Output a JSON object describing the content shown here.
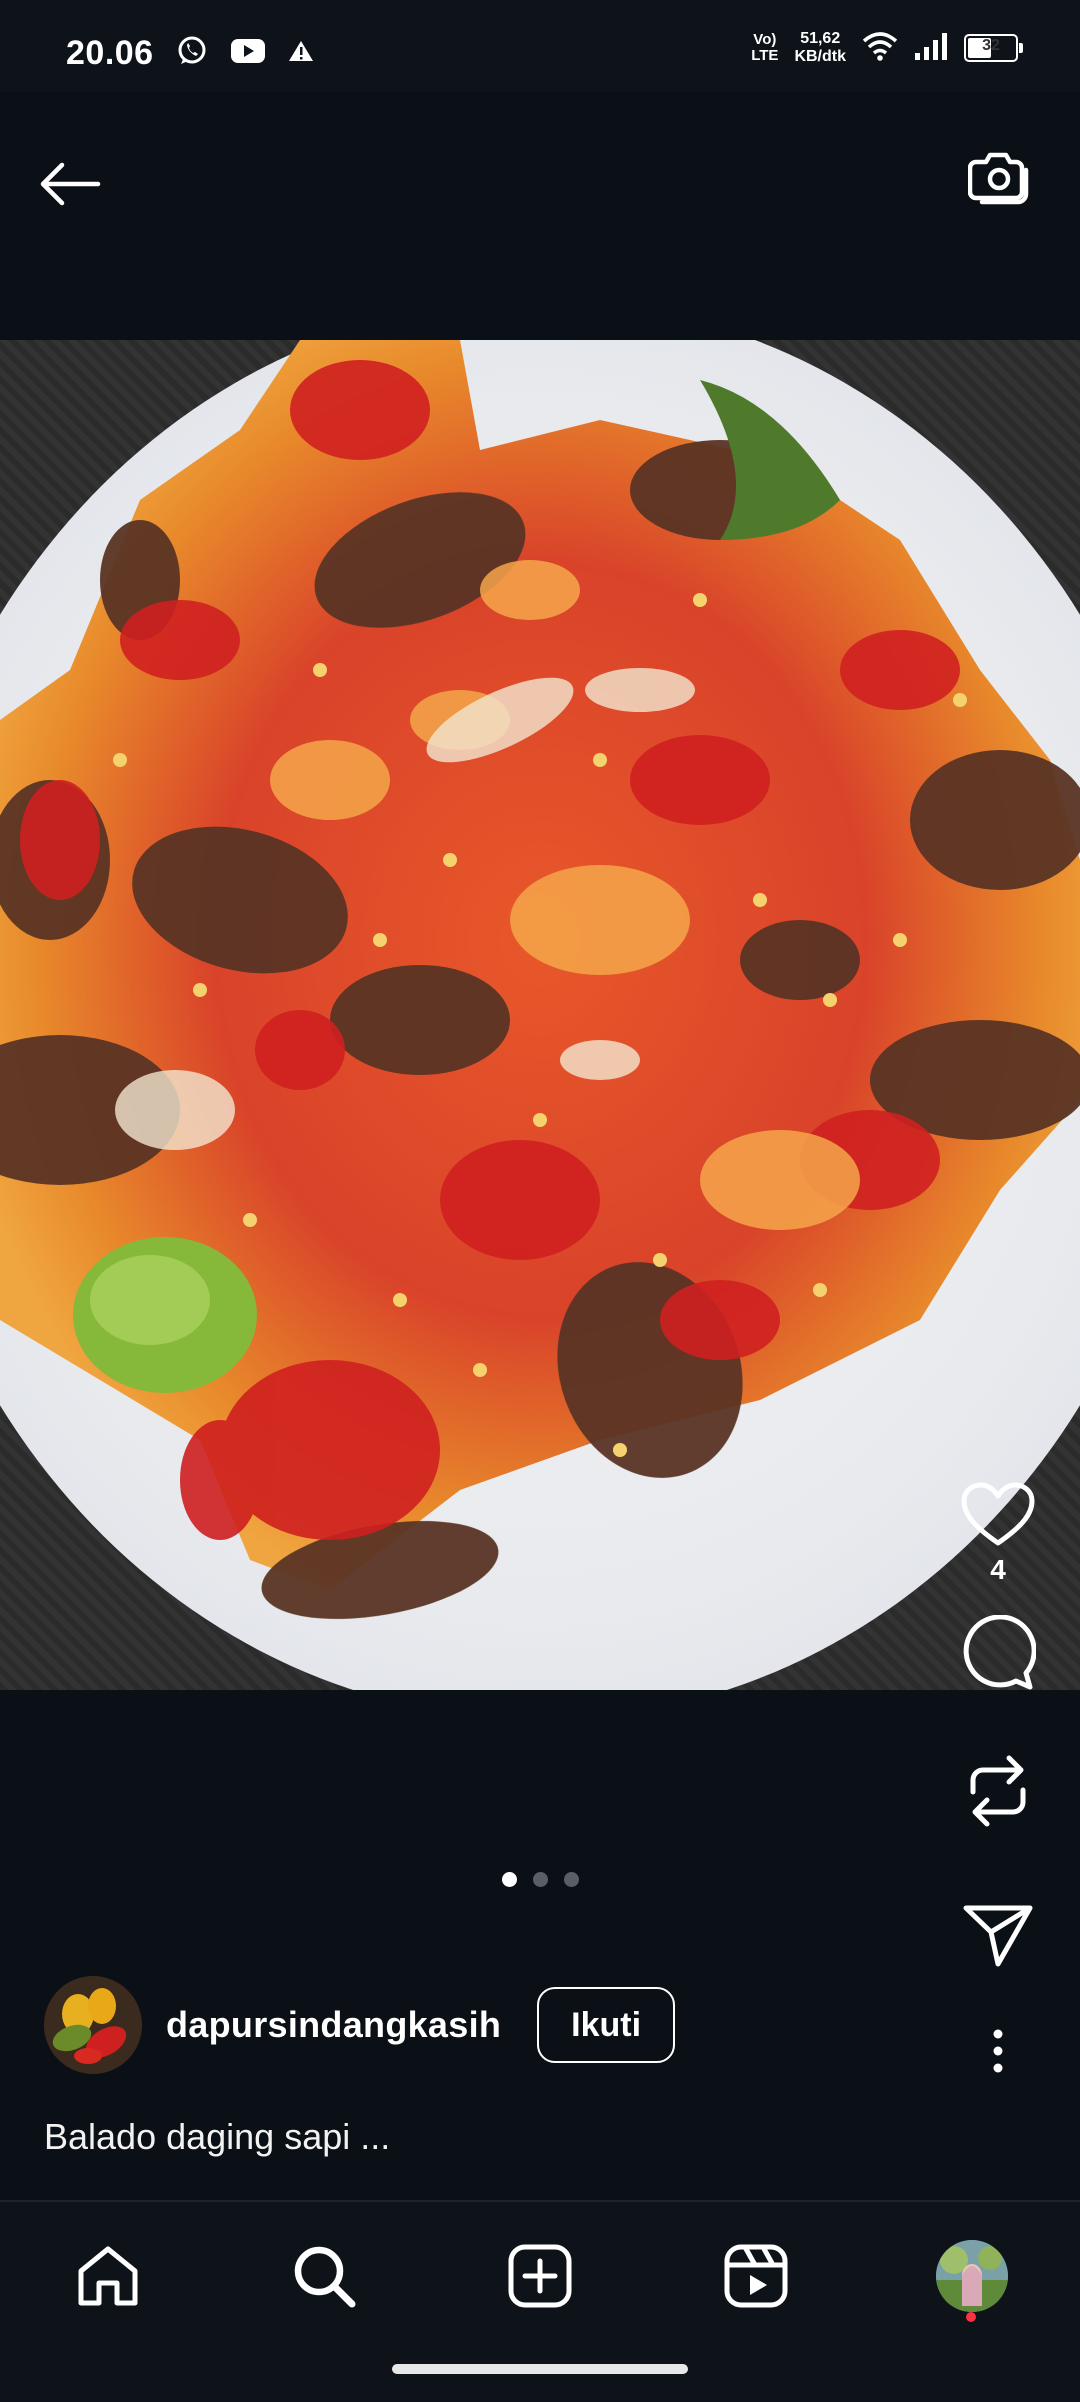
{
  "status_bar": {
    "time": "20.06",
    "volte_top": "Vo)",
    "volte_bottom": "LTE",
    "net_speed_value": "51,62",
    "net_speed_unit": "KB/dtk",
    "battery": "32",
    "notification_icons": [
      "whatsapp-icon",
      "youtube-icon",
      "warning-icon"
    ]
  },
  "post": {
    "likes": "4",
    "carousel": {
      "total": 3,
      "active": 0
    },
    "author": "dapursindangkasih",
    "follow_label": "Ikuti",
    "caption": "Balado daging sapi ..."
  },
  "nav": {
    "items": [
      "home-icon",
      "search-icon",
      "create-icon",
      "reels-icon",
      "profile-avatar"
    ],
    "active": "search-icon"
  },
  "colors": {
    "background": "#0b1016",
    "accent_notification": "#ff3040"
  }
}
